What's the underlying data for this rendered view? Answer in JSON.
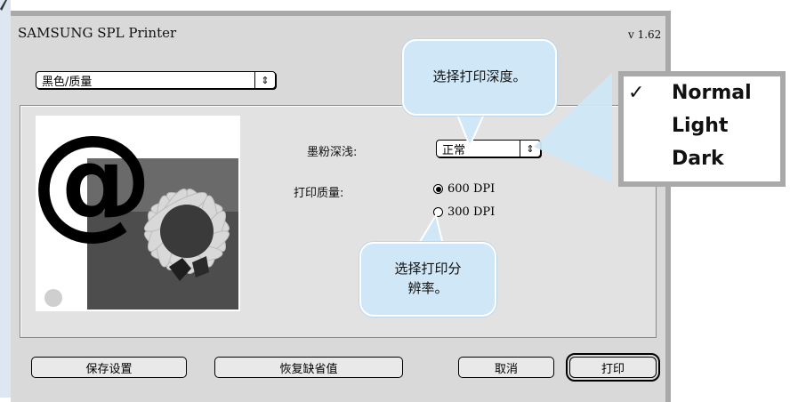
{
  "dialog": {
    "title": "SAMSUNG SPL Printer",
    "version": "v 1.62",
    "panel_popup": "黑色/质量"
  },
  "settings": {
    "toner_label": "墨粉深浅:",
    "toner_value": "正常",
    "quality_label": "打印质量:",
    "resolutions": [
      {
        "label": "600 DPI",
        "selected": true
      },
      {
        "label": "300 DPI",
        "selected": false
      }
    ]
  },
  "buttons": {
    "save": "保存设置",
    "restore": "恢复缺省值",
    "cancel": "取消",
    "print": "打印"
  },
  "callouts": {
    "darkness": "选择打印深度。",
    "resolution_line1": "选择打印分",
    "resolution_line2": "辨率。"
  },
  "menu": {
    "items": [
      {
        "label": "Normal",
        "checked": true
      },
      {
        "label": "Light",
        "checked": false
      },
      {
        "label": "Dark",
        "checked": false
      }
    ],
    "check_mark": "✓"
  },
  "icons": {
    "arrows": "⇕",
    "preview": "at-sign-sunflower-butterfly-image"
  },
  "colors": {
    "callout_fill": "#cfe7f6",
    "dialog_bg": "#d9d9d9"
  }
}
